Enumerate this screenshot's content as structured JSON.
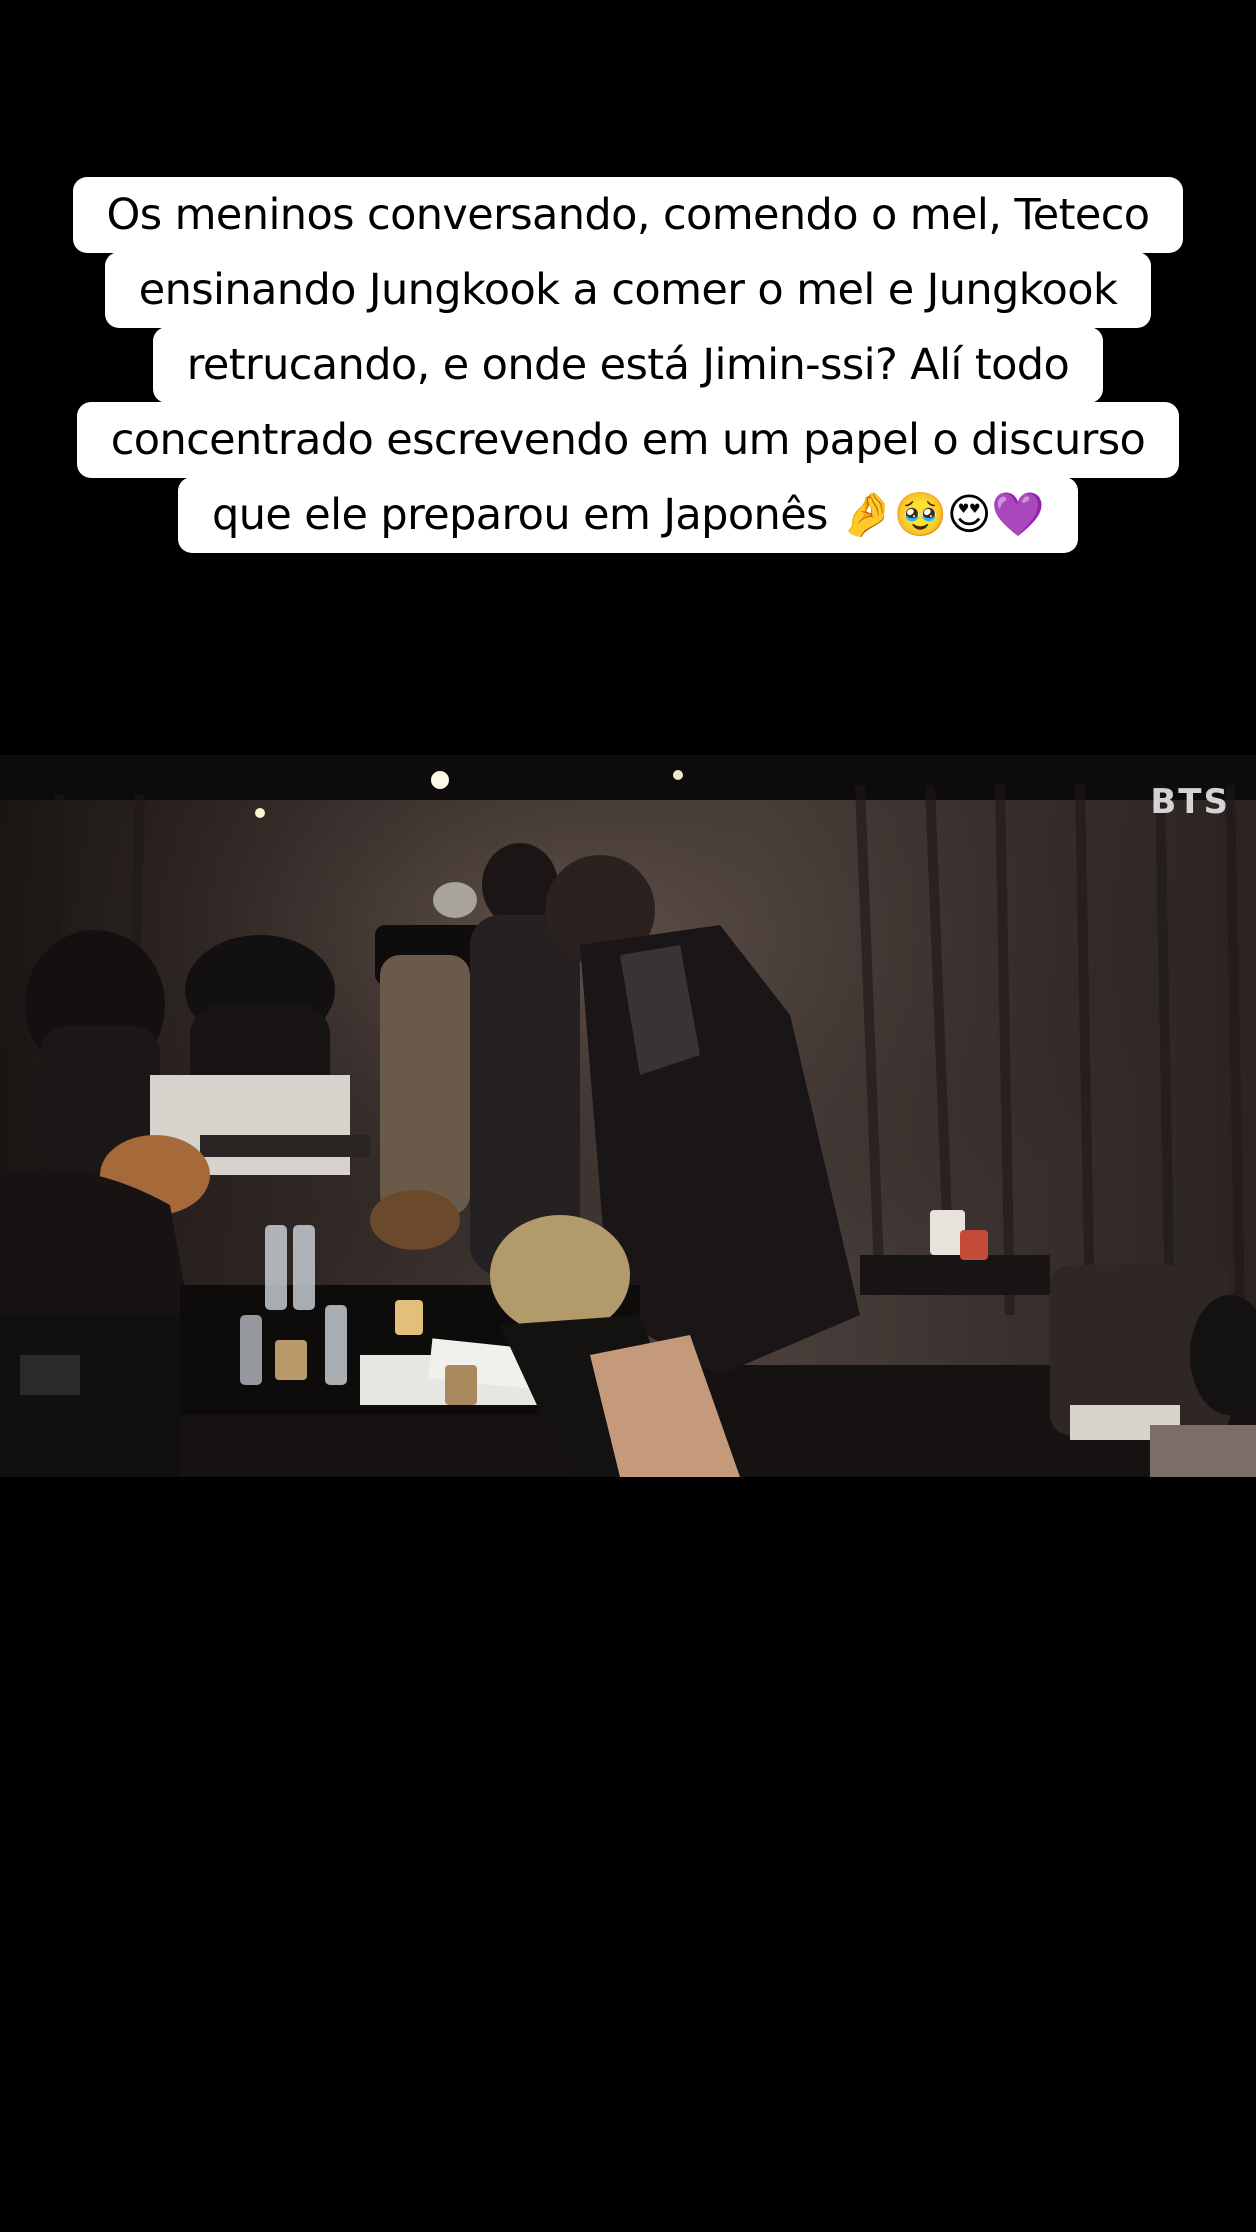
{
  "caption": {
    "lines": [
      "Os meninos conversando, comendo o mel, Teteco",
      "ensinando Jungkook a comer o mel e Jungkook",
      "retrucando, e onde está Jimin-ssi? Alí todo",
      "concentrado escrevendo em um papel o discurso",
      "que ele preparou em Japonês 🤌🥹😍💜"
    ]
  },
  "video": {
    "watermark": "BTS"
  }
}
